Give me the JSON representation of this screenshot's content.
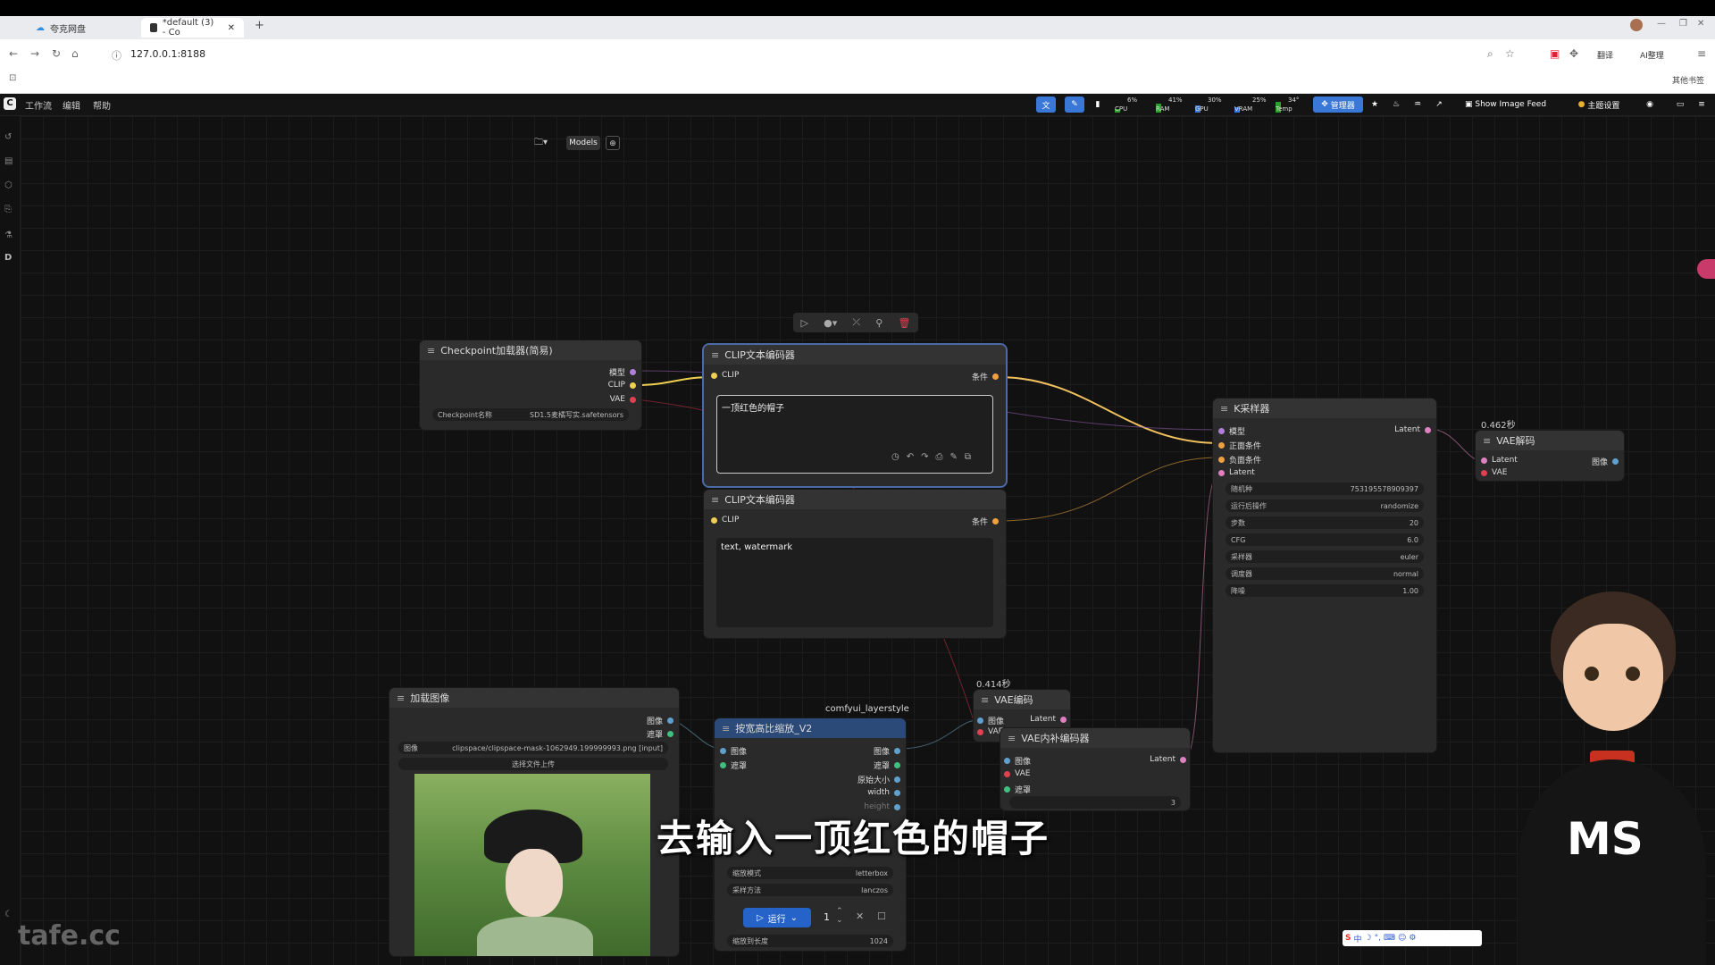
{
  "browser": {
    "tabs": [
      {
        "label": "夸克网盘",
        "active": false
      },
      {
        "label": "*default (3) - Co",
        "active": true
      }
    ],
    "new_tab": "+",
    "url": "127.0.0.1:8188",
    "right_buttons": [
      "翻译",
      "AI整理"
    ],
    "bookmark_right": "其他书签"
  },
  "app": {
    "menu": [
      "工作流",
      "编辑",
      "帮助"
    ],
    "meters": [
      {
        "label": "CPU",
        "value": "6%"
      },
      {
        "label": "RAM",
        "value": "41%"
      },
      {
        "label": "GPU",
        "value": "30%"
      },
      {
        "label": "VRAM",
        "value": "25%"
      },
      {
        "label": "Temp",
        "value": "34°"
      }
    ],
    "manager_label": "管理器",
    "show_image_feed": "Show Image Feed",
    "theme_label": "主题设置",
    "models_button": "Models",
    "accent": "#1f6fe5"
  },
  "nodes": {
    "checkpoint": {
      "title": "Checkpoint加载器(简易)",
      "outputs": [
        "模型",
        "CLIP",
        "VAE"
      ],
      "widget_label": "Checkpoint名称",
      "widget_value": "SD1.5麦橘写实.safetensors"
    },
    "clip_pos": {
      "title": "CLIP文本编码器",
      "input": "CLIP",
      "output": "条件",
      "text": "一顶红色的帽子"
    },
    "clip_neg": {
      "title": "CLIP文本编码器",
      "input": "CLIP",
      "output": "条件",
      "text": "text, watermark"
    },
    "ksampler": {
      "title": "K采样器",
      "inputs": [
        "模型",
        "正面条件",
        "负面条件",
        "Latent"
      ],
      "output": "Latent",
      "widgets": [
        {
          "label": "随机种",
          "value": "753195578909397"
        },
        {
          "label": "运行后操作",
          "value": "randomize"
        },
        {
          "label": "步数",
          "value": "20"
        },
        {
          "label": "CFG",
          "value": "6.0"
        },
        {
          "label": "采样器",
          "value": "euler"
        },
        {
          "label": "调度器",
          "value": "normal"
        },
        {
          "label": "降噪",
          "value": "1.00"
        }
      ]
    },
    "vae_decode": {
      "time": "0.462秒",
      "title": "VAE解码",
      "inputs": [
        "Latent",
        "VAE"
      ],
      "output": "图像"
    },
    "load_image": {
      "title": "加载图像",
      "outputs": [
        "图像",
        "遮罩"
      ],
      "widget_label": "图像",
      "widget_value": "clipspace/clipspace-mask-1062949.199999993.png [input]",
      "upload_label": "选择文件上传"
    },
    "scale": {
      "group": "comfyui_layerstyle",
      "title": "按宽高比缩放_V2",
      "inputs": [
        "图像",
        "遮罩"
      ],
      "outputs": [
        "图像",
        "遮罩",
        "原始大小",
        "width",
        "height"
      ],
      "widgets": [
        {
          "label": "缩放模式",
          "value": "letterbox"
        },
        {
          "label": "采样方法",
          "value": "lanczos"
        },
        {
          "label": "缩放到长度",
          "value": "1024"
        }
      ]
    },
    "vae_encode": {
      "time": "0.414秒",
      "title": "VAE编码",
      "inputs": [
        "图像",
        "VAE"
      ],
      "output": "Latent"
    },
    "vae_inpaint": {
      "title": "VAE内补编码器",
      "inputs": [
        "图像",
        "VAE",
        "遮罩"
      ],
      "output": "Latent",
      "widget_value": "3"
    }
  },
  "runbar": {
    "run_label": "运行",
    "count": "1"
  },
  "subtitle": "去输入一顶红色的帽子",
  "watermark": "tafe.cc",
  "avatar_shirt": "MS"
}
